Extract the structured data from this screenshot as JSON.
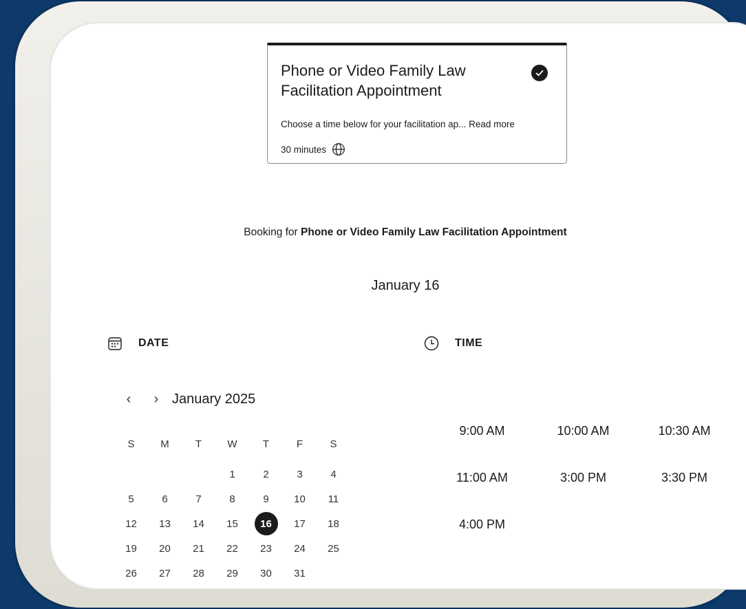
{
  "service_card": {
    "title": "Phone or Video Family Law Facilitation Appointment",
    "description": "Choose a time below for your facilitation ap...",
    "read_more": "Read more",
    "duration": "30 minutes",
    "selected": true
  },
  "booking": {
    "prefix": "Booking for ",
    "service_name": "Phone or Video Family Law Facilitation Appointment"
  },
  "selected_date": "January 16",
  "date_section": {
    "label": "DATE",
    "icon": "calendar-icon"
  },
  "time_section": {
    "label": "TIME",
    "icon": "clock-icon"
  },
  "calendar": {
    "month": "January 2025",
    "prev_icon": "chevron-left-icon",
    "next_icon": "chevron-right-icon",
    "weekdays": [
      "S",
      "M",
      "T",
      "W",
      "T",
      "F",
      "S"
    ],
    "weeks": [
      [
        "",
        "",
        "",
        "1",
        "2",
        "3",
        "4"
      ],
      [
        "5",
        "6",
        "7",
        "8",
        "9",
        "10",
        "11"
      ],
      [
        "12",
        "13",
        "14",
        "15",
        "16",
        "17",
        "18"
      ],
      [
        "19",
        "20",
        "21",
        "22",
        "23",
        "24",
        "25"
      ],
      [
        "26",
        "27",
        "28",
        "29",
        "30",
        "31",
        ""
      ]
    ],
    "selected_day": "16"
  },
  "time_slots": [
    "9:00 AM",
    "10:00 AM",
    "10:30 AM",
    "11:00 AM",
    "3:00 PM",
    "3:30 PM",
    "4:00 PM"
  ],
  "colors": {
    "background": "#0d3a6b",
    "accent": "#1b1b1b",
    "text": "#1b1b1b"
  }
}
